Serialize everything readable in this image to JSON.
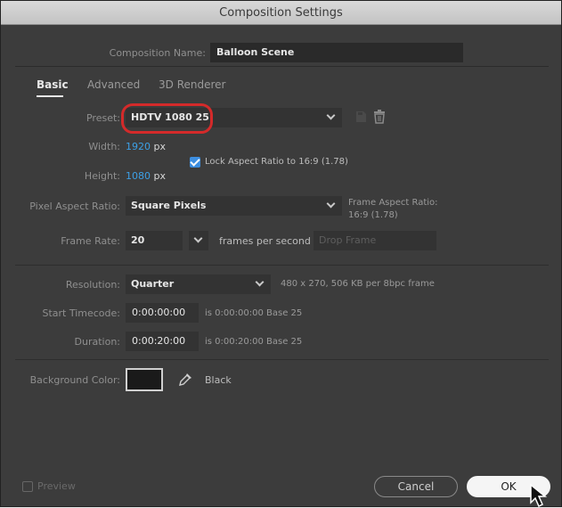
{
  "window": {
    "title": "Composition Settings"
  },
  "composition_name": {
    "label": "Composition Name:",
    "value": "Balloon Scene"
  },
  "tabs": [
    {
      "label": "Basic",
      "active": true
    },
    {
      "label": "Advanced",
      "active": false
    },
    {
      "label": "3D Renderer",
      "active": false
    }
  ],
  "preset": {
    "label": "Preset:",
    "value": "HDTV 1080 25"
  },
  "width": {
    "label": "Width:",
    "value": "1920",
    "unit": "px"
  },
  "height": {
    "label": "Height:",
    "value": "1080",
    "unit": "px"
  },
  "lock_aspect": {
    "label": "Lock Aspect Ratio to 16:9 (1.78)",
    "checked": true
  },
  "pixel_aspect": {
    "label": "Pixel Aspect Ratio:",
    "value": "Square Pixels",
    "frame_label": "Frame Aspect Ratio:",
    "frame_value": "16:9 (1.78)"
  },
  "frame_rate": {
    "label": "Frame Rate:",
    "value": "20",
    "unit": "frames per second",
    "drop_frame": "Drop Frame"
  },
  "resolution": {
    "label": "Resolution:",
    "value": "Quarter",
    "info": "480 x 270, 506 KB per 8bpc frame"
  },
  "start_timecode": {
    "label": "Start Timecode:",
    "value": "0:00:00:00",
    "info": "is 0:00:00:00  Base 25"
  },
  "duration": {
    "label": "Duration:",
    "value": "0:00:20:00",
    "info": "is 0:00:20:00  Base 25"
  },
  "background_color": {
    "label": "Background Color:",
    "swatch": "#1a1a1a",
    "name": "Black"
  },
  "footer": {
    "preview": "Preview",
    "cancel": "Cancel",
    "ok": "OK"
  },
  "colors": {
    "accent": "#3da0e6",
    "highlight": "#d42a2a"
  }
}
